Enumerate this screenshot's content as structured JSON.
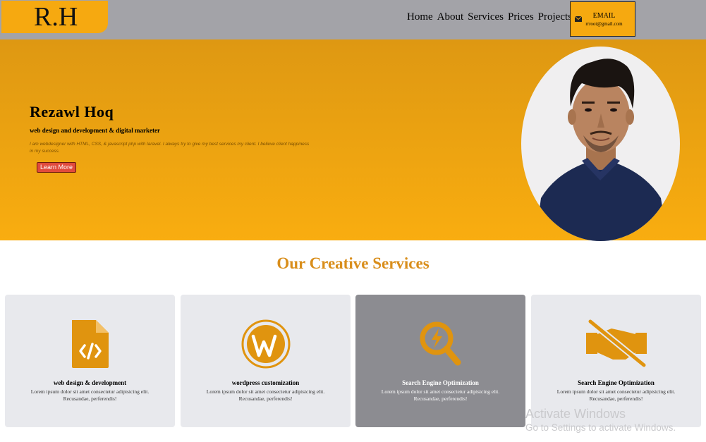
{
  "header": {
    "logo": "R.H",
    "nav": [
      "Home",
      "About",
      "Services",
      "Prices",
      "Projects"
    ],
    "email_title": "EMAIL",
    "email_address": "rrroot@gmail.com"
  },
  "hero": {
    "name": "Rezawl Hoq",
    "role": "web design and development & digital marketer",
    "description": "I am webdesigner with HTML, CSS, & javascript php with laravel. I always try to give my best services my client. I believe client happiness in my success.",
    "button": "Learn More"
  },
  "services": {
    "title": "Our Creative Services",
    "cards": [
      {
        "icon": "file-code-icon",
        "title": "web design & development",
        "desc": "Lorem ipsum dolor sit amet consectetur adipisicing elit. Recusandae, perferendis!"
      },
      {
        "icon": "wordpress-icon",
        "title": "wordpress customization",
        "desc": "Lorem ipsum dolor sit amet consectetur adipisicing elit. Recusandae, perferendis!"
      },
      {
        "icon": "search-bolt-icon",
        "title": "Search Engine Optimization",
        "desc": "Lorem ipsum dolor sit amet consectetur adipisicing elit. Recusandae, perferendis!"
      },
      {
        "icon": "handshake-slash-icon",
        "title": "Search Engine Optimization",
        "desc": "Lorem ipsum dolor sit amet consectetur adipisicing elit. Recusandae, perferendis!"
      }
    ]
  },
  "watermark": {
    "line1": "Activate Windows",
    "line2": "Go to Settings to activate Windows."
  },
  "colors": {
    "accent": "#f6a910",
    "header_bg": "#a3a3a8",
    "title": "#d98e1b",
    "icon": "#e0940f",
    "button": "#e04a3c"
  }
}
